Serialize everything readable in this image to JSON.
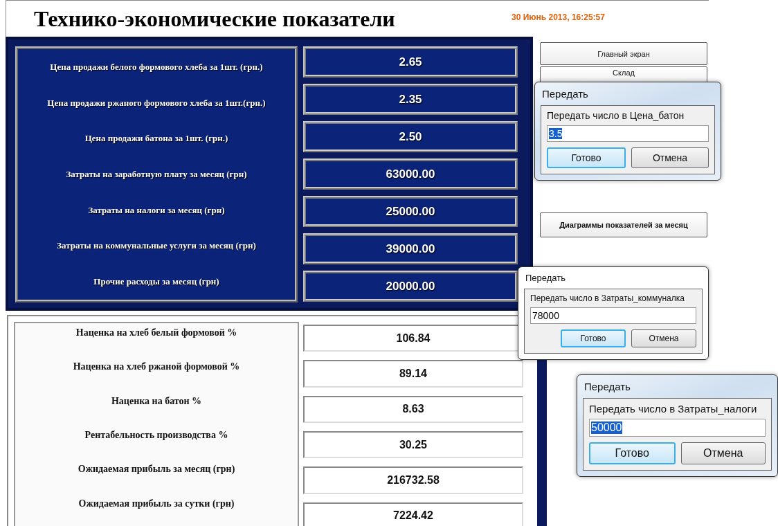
{
  "header": {
    "title": "Технико-экономические показатели",
    "datetime": "30 Июнь 2013, 16:25:57"
  },
  "inputs": [
    {
      "label": "Цена продажи белого формового хлеба за 1шт. (грн.)",
      "value": "2.65"
    },
    {
      "label": "Цена продажи ржаного формового хлеба за 1шт.(грн.)",
      "value": "2.35"
    },
    {
      "label": "Цена продажи батона за 1шт. (грн.)",
      "value": "2.50"
    },
    {
      "label": "Затраты на заработную плату за месяц (грн)",
      "value": "63000.00"
    },
    {
      "label": "Затраты на налоги за месяц (грн)",
      "value": "25000.00"
    },
    {
      "label": "Затраты на коммунальные услуги за месяц (грн)",
      "value": "39000.00"
    },
    {
      "label": "Прочие расходы за месяц (грн)",
      "value": "20000.00"
    }
  ],
  "results": [
    {
      "label": "Наценка на хлеб белый формовой %",
      "value": "106.84"
    },
    {
      "label": "Наценка на хлеб ржаной формовой %",
      "value": "89.14"
    },
    {
      "label": "Наценка на батон %",
      "value": "8.63"
    },
    {
      "label": "Рентабельность производства %",
      "value": "30.25"
    },
    {
      "label": "Ожидаемая прибыль за месяц (грн)",
      "value": "216732.58"
    },
    {
      "label": "Ожидаемая прибыль за сутки (грн)",
      "value": "7224.42"
    }
  ],
  "sidebar": {
    "buttons": [
      {
        "label": "Главный экран"
      },
      {
        "label": "Склад"
      },
      {
        "label": "Диаграммы показателей за месяц"
      }
    ]
  },
  "dialogs": [
    {
      "title": "Передать",
      "prompt": "Передать число в Цена_батон",
      "value": "3.5",
      "value_selected": true,
      "buttons": [
        {
          "label": "Готово",
          "focused": true
        },
        {
          "label": "Отмена",
          "focused": false
        }
      ]
    },
    {
      "title": "Передать",
      "prompt": "Передать число в Затраты_коммуналка",
      "value": "78000",
      "value_selected": false,
      "buttons": [
        {
          "label": "Готово",
          "focused": true
        },
        {
          "label": "Отмена",
          "focused": false
        }
      ]
    },
    {
      "title": "Передать",
      "prompt": "Передать число в Затраты_налоги",
      "value": "50000",
      "value_selected": true,
      "buttons": [
        {
          "label": "Готово",
          "focused": true
        },
        {
          "label": "Отмена",
          "focused": false
        }
      ]
    }
  ]
}
